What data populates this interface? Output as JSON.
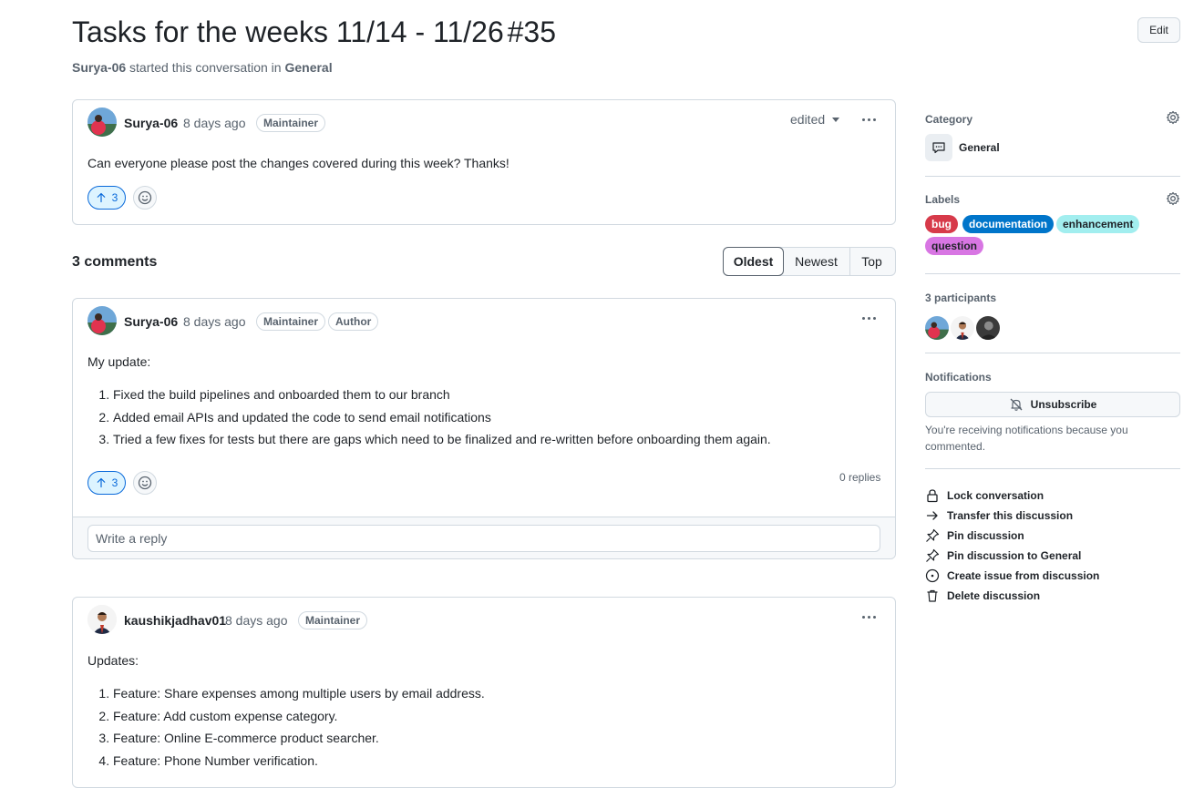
{
  "header": {
    "title": "Tasks for the weeks 11/14 - 11/26",
    "number": "#35",
    "author": "Surya-06",
    "started_text": "started this conversation in",
    "category": "General",
    "edit_label": "Edit"
  },
  "post": {
    "author": "Surya-06",
    "time": "8 days ago",
    "badge": "Maintainer",
    "edited_label": "edited",
    "text": "Can everyone please post the changes covered during this week? Thanks!",
    "upvotes": "3"
  },
  "comments_header": {
    "count_label": "3 comments",
    "sort_options": [
      "Oldest",
      "Newest",
      "Top"
    ],
    "selected_sort": "Oldest"
  },
  "comment1": {
    "author": "Surya-06",
    "time": "8 days ago",
    "badges": [
      "Maintainer",
      "Author"
    ],
    "intro": "My update:",
    "items": [
      "Fixed the build pipelines and onboarded them to our branch",
      "Added email APIs and updated the code to send email notifications",
      "Tried a few fixes for tests but there are gaps which need to be finalized and re-written before onboarding them again."
    ],
    "upvotes": "3",
    "replies": "0 replies",
    "reply_placeholder": "Write a reply"
  },
  "comment2": {
    "author": "kaushikjadhav01",
    "time": "8 days ago",
    "badge": "Maintainer",
    "intro": "Updates:",
    "items": [
      "Feature: Share expenses among multiple users by email address.",
      "Feature: Add custom expense category.",
      "Feature: Online E-commerce product searcher.",
      "Feature: Phone Number verification."
    ]
  },
  "sidebar": {
    "category_label": "Category",
    "category_value": "General",
    "labels_label": "Labels",
    "labels": [
      {
        "name": "bug",
        "bg": "#d73a4a",
        "fg": "#ffffff"
      },
      {
        "name": "documentation",
        "bg": "#0075ca",
        "fg": "#ffffff"
      },
      {
        "name": "enhancement",
        "bg": "#a2eeef",
        "fg": "#1f2328"
      },
      {
        "name": "question",
        "bg": "#d876e3",
        "fg": "#1f2328"
      }
    ],
    "participants_label": "3 participants",
    "notifications_label": "Notifications",
    "unsubscribe_label": "Unsubscribe",
    "notif_reason": "You're receiving notifications because you commented.",
    "actions": [
      {
        "label": "Lock conversation",
        "icon": "lock-icon"
      },
      {
        "label": "Transfer this discussion",
        "icon": "arrow-right-icon"
      },
      {
        "label": "Pin discussion",
        "icon": "pin-icon"
      },
      {
        "label": "Pin discussion to General",
        "icon": "pin-icon"
      },
      {
        "label": "Create issue from discussion",
        "icon": "issue-opened-icon"
      },
      {
        "label": "Delete discussion",
        "icon": "trash-icon"
      }
    ]
  },
  "colors": {
    "accent": "#0969da",
    "border": "#d1d9e0",
    "muted": "#59636e"
  }
}
